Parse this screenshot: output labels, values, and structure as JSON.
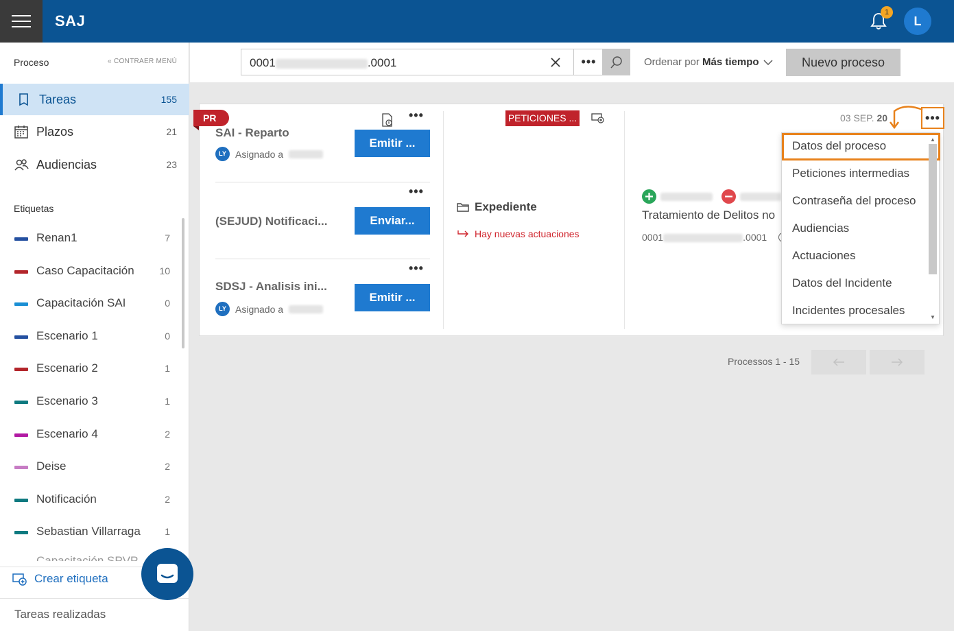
{
  "app": {
    "brand": "SAJ",
    "notification_count": "1",
    "user_initial": "L"
  },
  "sidebar": {
    "section_title": "Proceso",
    "collapse_label": "CONTRAER MENÚ",
    "nav": [
      {
        "label": "Tareas",
        "count": "155",
        "icon": "book-icon",
        "active": true
      },
      {
        "label": "Plazos",
        "count": "21",
        "icon": "calendar-icon",
        "active": false
      },
      {
        "label": "Audiencias",
        "count": "23",
        "icon": "people-icon",
        "active": false
      }
    ],
    "tags_title": "Etiquetas",
    "tags": [
      {
        "label": "Renan1",
        "count": "7",
        "color": "#2450a0"
      },
      {
        "label": "Caso Capacitación",
        "count": "10",
        "color": "#b3252b"
      },
      {
        "label": "Capacitación SAI",
        "count": "0",
        "color": "#1a8fd4"
      },
      {
        "label": "Escenario 1",
        "count": "0",
        "color": "#2450a0"
      },
      {
        "label": "Escenario 2",
        "count": "1",
        "color": "#b3252b"
      },
      {
        "label": "Escenario 3",
        "count": "1",
        "color": "#0f7a80"
      },
      {
        "label": "Escenario 4",
        "count": "2",
        "color": "#b21aa3"
      },
      {
        "label": "Deise",
        "count": "2",
        "color": "#c77cc4"
      },
      {
        "label": "Notificación",
        "count": "2",
        "color": "#0f7a80"
      },
      {
        "label": "Sebastian Villarraga",
        "count": "1",
        "color": "#0f7a80"
      }
    ],
    "partial_tag": "Capacitación SPVP",
    "create_tag_label": "Crear etiqueta",
    "done_label": "Tareas realizadas"
  },
  "search": {
    "value_prefix": "0001",
    "value_suffix": ".0001",
    "order_label": "Ordenar por",
    "order_value": "Más tiempo",
    "new_button": "Nuevo proceso"
  },
  "card": {
    "flag": "PR",
    "tasks": [
      {
        "title": "SAI - Reparto",
        "button": "Emitir ...",
        "assigned": "Asignado a",
        "avatar": "LY"
      },
      {
        "title": "(SEJUD) Notificaci...",
        "button": "Enviar..."
      },
      {
        "title": "SDSJ - Analisis ini...",
        "button": "Emitir ...",
        "assigned": "Asignado a",
        "avatar": "LY"
      }
    ],
    "petition_badge": "PETICIONES ...",
    "expediente_title": "Expediente",
    "new_actions": "Hay nuevas actuaciones",
    "date_prefix": "03 SEP.",
    "date_bold": "20",
    "crime_title": "Tratamiento de Delitos no",
    "proc_prefix": "0001",
    "proc_suffix": ".0001"
  },
  "menu": {
    "items": [
      "Datos del proceso",
      "Peticiones intermedias",
      "Contraseña del proceso",
      "Audiencias",
      "Actuaciones",
      "Datos del Incidente",
      "Incidentes procesales"
    ],
    "highlight_color": "#e8821c"
  },
  "pagination": {
    "label": "Processos 1 - 15"
  }
}
